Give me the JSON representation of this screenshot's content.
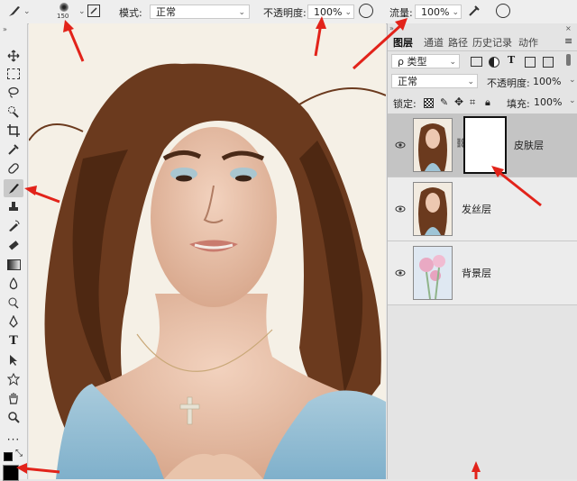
{
  "options_bar": {
    "brush_size": "150",
    "mode_label": "模式:",
    "mode_value": "正常",
    "opacity_label": "不透明度:",
    "opacity_value": "100%",
    "flow_label": "流量:",
    "flow_value": "100%"
  },
  "panel": {
    "tabs": [
      "图层",
      "通道",
      "路径",
      "历史记录",
      "动作"
    ],
    "filter_label": "ρ 类型",
    "blend_mode": "正常",
    "opacity_label": "不透明度:",
    "opacity_value": "100%",
    "lock_label": "锁定:",
    "fill_label": "填充:",
    "fill_value": "100%",
    "layers": [
      {
        "name": "皮肤层",
        "selected": true,
        "has_mask": true
      },
      {
        "name": "发丝层",
        "selected": false,
        "has_mask": false
      },
      {
        "name": "背景层",
        "selected": false,
        "has_mask": false
      }
    ]
  },
  "colors": {
    "ui_bg": "#eeeeee",
    "panel_bg": "#e4e4e4",
    "selected_layer": "#c4c4c4",
    "annotation_arrow": "#e2231a",
    "canvas_bg": "#f4efe4"
  }
}
